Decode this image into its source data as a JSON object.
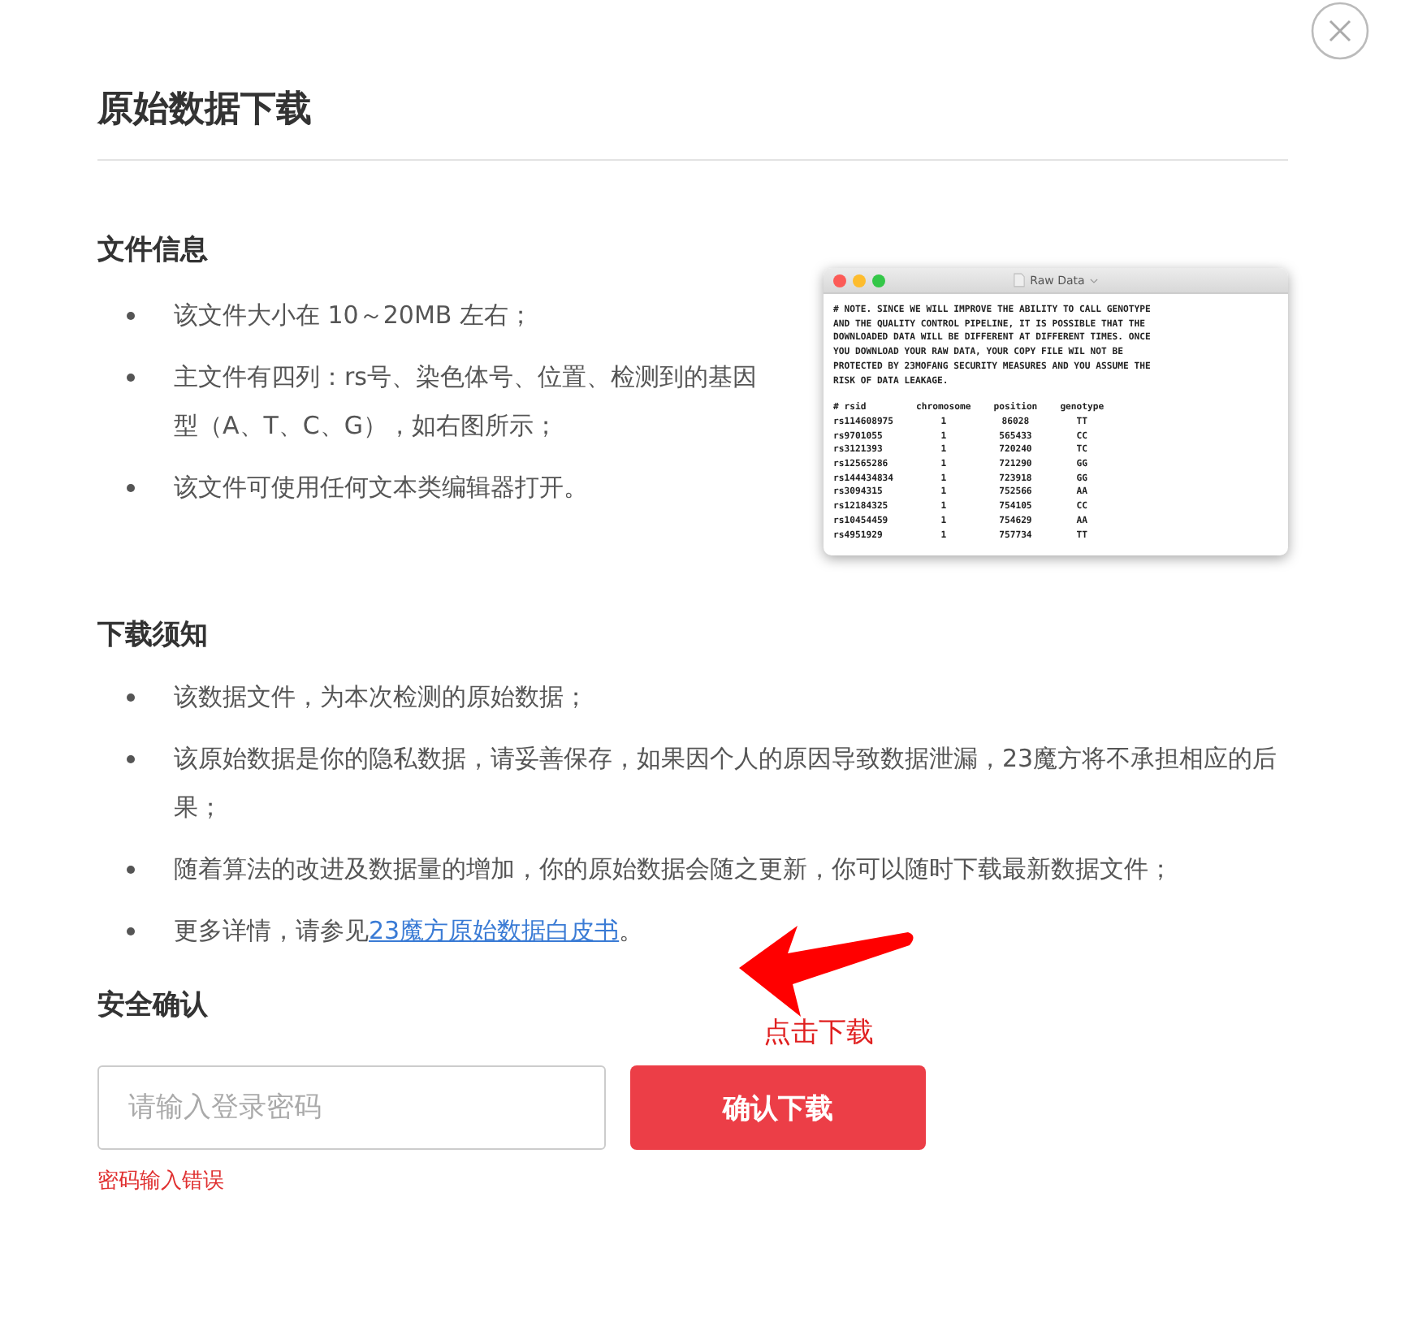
{
  "dialog": {
    "title": "原始数据下载"
  },
  "file_info": {
    "heading": "文件信息",
    "bullets": [
      "该文件大小在 10～20MB 左右；",
      "主文件有四列：rs号、染色体号、位置、检测到的基因型（A、T、C、G），如右图所示；",
      "该文件可使用任何文本类编辑器打开。"
    ],
    "preview_window": {
      "title": "Raw Data",
      "note_lines": [
        "# NOTE. SINCE WE WILL IMPROVE THE ABILITY TO CALL GENOTYPE",
        "AND THE QUALITY CONTROL PIPELINE, IT IS POSSIBLE THAT THE",
        "DOWNLOADED DATA WILL BE DIFFERENT AT DIFFERENT TIMES. ONCE",
        "YOU DOWNLOAD YOUR RAW DATA, YOUR COPY FILE WIL NOT BE",
        "PROTECTED BY 23MOFANG SECURITY MEASURES AND YOU ASSUME THE",
        "RISK OF DATA LEAKAGE."
      ],
      "columns": [
        "# rsid",
        "chromosome",
        "position",
        "genotype"
      ],
      "rows": [
        [
          "rs114608975",
          "1",
          "86028",
          "TT"
        ],
        [
          "rs9701055",
          "1",
          "565433",
          "CC"
        ],
        [
          "rs3121393",
          "1",
          "720240",
          "TC"
        ],
        [
          "rs12565286",
          "1",
          "721290",
          "GG"
        ],
        [
          "rs144434834",
          "1",
          "723918",
          "GG"
        ],
        [
          "rs3094315",
          "1",
          "752566",
          "AA"
        ],
        [
          "rs12184325",
          "1",
          "754105",
          "CC"
        ],
        [
          "rs10454459",
          "1",
          "754629",
          "AA"
        ],
        [
          "rs4951929",
          "1",
          "757734",
          "TT"
        ]
      ]
    }
  },
  "download_notice": {
    "heading": "下载须知",
    "bullets": [
      {
        "text": "该数据文件，为本次检测的原始数据；"
      },
      {
        "text": "该原始数据是你的隐私数据，请妥善保存，如果因个人的原因导致数据泄漏，23魔方将不承担相应的后果；"
      },
      {
        "text": "随着算法的改进及数据量的增加，你的原始数据会随之更新，你可以随时下载最新数据文件；"
      },
      {
        "text": "更多详情，请参见",
        "link": "23魔方原始数据白皮书",
        "after": "。"
      }
    ]
  },
  "annotation": {
    "label": "点击下载"
  },
  "security": {
    "heading": "安全确认",
    "password_field": {
      "placeholder": "请输入登录密码"
    },
    "confirm_button": "确认下载",
    "error": "密码输入错误"
  }
}
